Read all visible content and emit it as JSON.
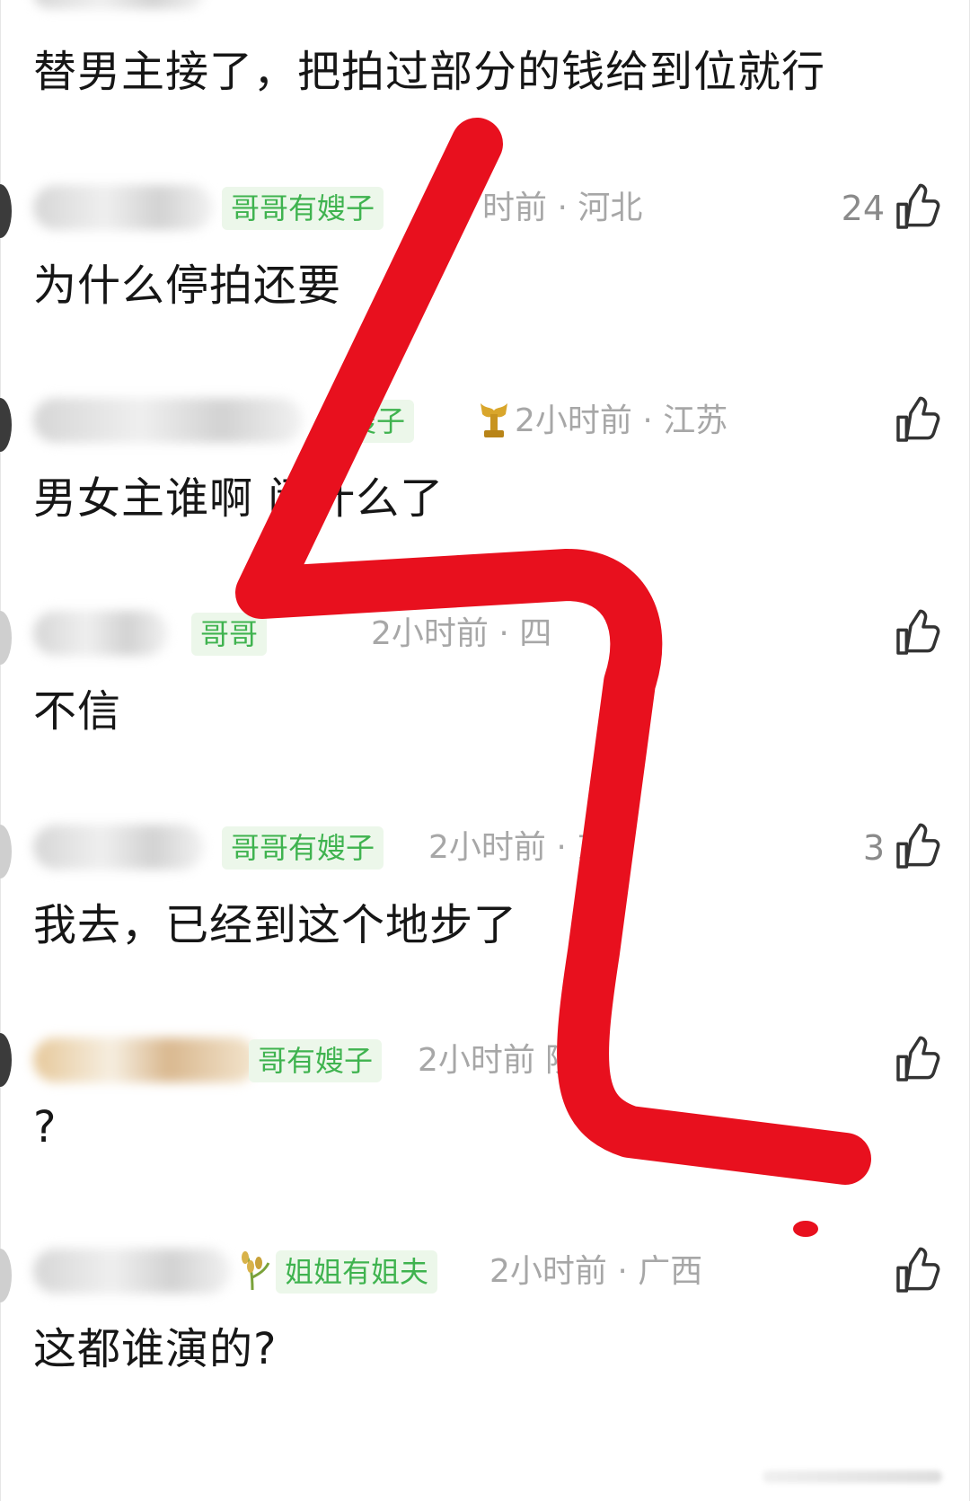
{
  "colors": {
    "badge_bg": "#ecf7ea",
    "badge_text": "#3fb34f",
    "meta_text": "#a7a7a7",
    "comment_text": "#161616",
    "scribble": "#e8101e"
  },
  "top_comment": {
    "text": "替男主接了，把拍过部分的钱给到位就行"
  },
  "comments": [
    {
      "badge": "哥哥有嫂子",
      "time_location": "时前 · 河北",
      "likes": "24",
      "text": "为什么停拍还要",
      "like_icon": "thumbs-up-icon"
    },
    {
      "badge": "嫂子",
      "deco_icon": "trophy-icon",
      "time_location": "2小时前 · 江苏",
      "likes": "",
      "text": "男女主谁啊  闹什么了",
      "like_icon": "thumbs-up-icon"
    },
    {
      "badge": "哥哥",
      "time_location": "2小时前 · 四",
      "likes": "",
      "text": "不信",
      "like_icon": "thumbs-up-icon"
    },
    {
      "badge": "哥哥有嫂子",
      "time_location": "2小时前 ·   东",
      "likes": "3",
      "text": "我去，已经到这个地步了",
      "like_icon": "thumbs-up-icon"
    },
    {
      "badge": "哥有嫂子",
      "time_location": "2小时前   陕西",
      "likes": "",
      "text": "?",
      "like_icon": "thumbs-up-icon"
    },
    {
      "badge": "姐姐有姐夫",
      "deco_icon": "rice-plant-icon",
      "time_location": "2小时前 · 广西",
      "likes": "",
      "text": "这都谁演的?",
      "like_icon": "thumbs-up-icon"
    }
  ]
}
